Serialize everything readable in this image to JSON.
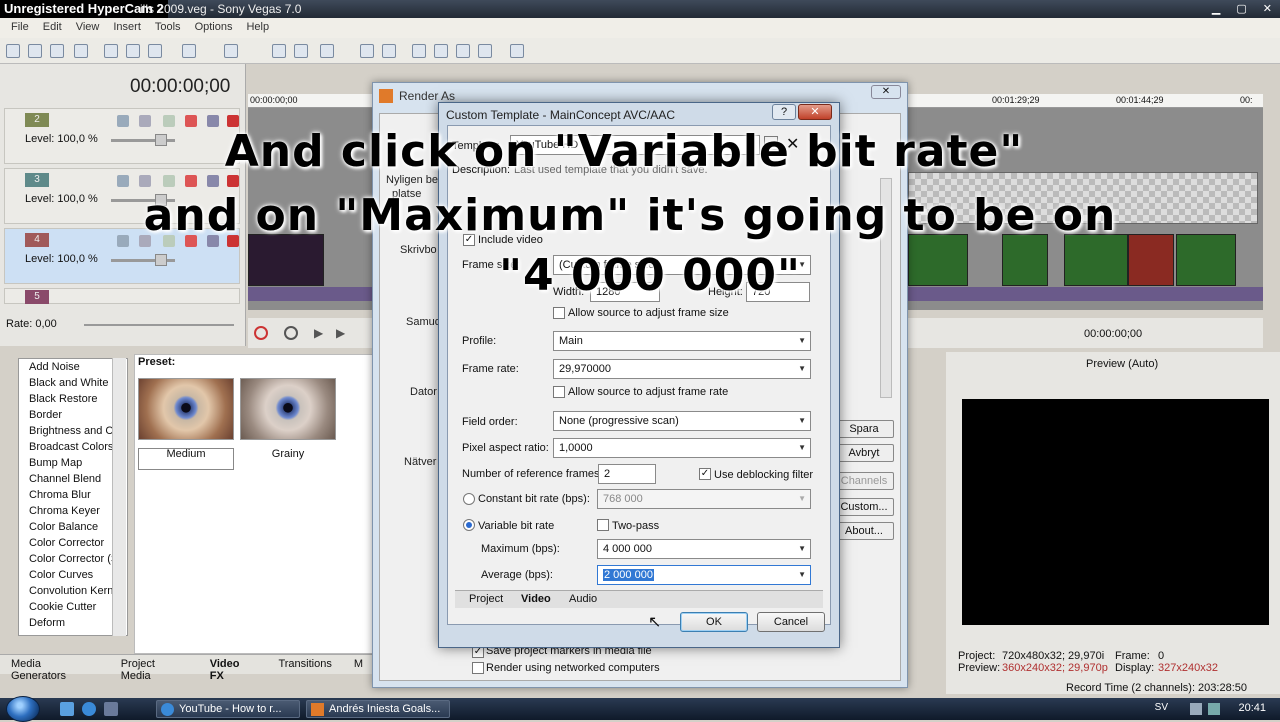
{
  "titlebar": {
    "hypercam": "Unregistered HyperCam 2",
    "title": "Andrés Iniesta Goals and Skills 2009.veg - Sony Vegas 7.0",
    "title_visible": "ills 2009.veg - Sony Vegas 7.0"
  },
  "menu": [
    "File",
    "Edit",
    "View",
    "Insert",
    "Tools",
    "Options",
    "Help"
  ],
  "timeline": {
    "timecode": "00:00:00;00",
    "ruler": [
      "00:00:00;00",
      "00:01:29;29",
      "00:01:44;29",
      "00:"
    ],
    "tracks": [
      {
        "num": "2",
        "level": "Level: 100,0 %"
      },
      {
        "num": "3",
        "level": "Level: 100,0 %"
      },
      {
        "num": "4",
        "level": "Level: 100,0 %"
      },
      {
        "num": "5"
      }
    ],
    "rate": "Rate: 0,00",
    "cursor_time": "00:00:00;00"
  },
  "fx": {
    "items": [
      "Add Noise",
      "Black and White",
      "Black Restore",
      "Border",
      "Brightness and Co",
      "Broadcast Colors",
      "Bump Map",
      "Channel Blend",
      "Chroma Blur",
      "Chroma Keyer",
      "Color Balance",
      "Color Corrector",
      "Color Corrector (S",
      "Color Curves",
      "Convolution Kerne",
      "Cookie Cutter",
      "Deform"
    ],
    "preset_label": "Preset:",
    "presets": [
      "Medium",
      "Grainy"
    ]
  },
  "bottom_tabs": [
    "Media Generators",
    "Project Media",
    "Video FX",
    "Transitions",
    "M"
  ],
  "preview": {
    "mode": "Preview (Auto)",
    "project_label": "Project:",
    "project_value": "720x480x32; 29,970i",
    "frame_label": "Frame:",
    "frame_value": "0",
    "preview_label": "Preview:",
    "preview_value": "360x240x32; 29,970p",
    "display_label": "Display:",
    "display_value": "327x240x32",
    "record_time": "Record Time (2 channels): 203:28:50"
  },
  "render_as": {
    "title": "Render As",
    "sidebar": [
      "Nyligen be",
      "platse",
      "Skrivbo",
      "Samud",
      "Dator",
      "Nätver"
    ],
    "buttons": [
      "Spara",
      "Avbryt",
      "Channels",
      "Custom...",
      "About..."
    ],
    "save_markers": "Save project markers in media file",
    "networked": "Render using networked computers"
  },
  "custom_template": {
    "title": "Custom Template - MainConcept AVC/AAC",
    "template_label": "Template:",
    "template_value": "YouTube HD",
    "description_label": "Description:",
    "description_value": "Last used template that you didn't save.",
    "include_video": "Include video",
    "frame_size_label": "Frame size:",
    "frame_size_value": "(Custom frame size)",
    "width_label": "Width:",
    "width_value": "1280",
    "height_label": "Height:",
    "height_value": "720",
    "allow_frame_size": "Allow source to adjust frame size",
    "profile_label": "Profile:",
    "profile_value": "Main",
    "frame_rate_label": "Frame rate:",
    "frame_rate_value": "29,970000",
    "allow_frame_rate": "Allow source to adjust frame rate",
    "field_order_label": "Field order:",
    "field_order_value": "None (progressive scan)",
    "par_label": "Pixel aspect ratio:",
    "par_value": "1,0000",
    "ref_frames_label": "Number of reference frames:",
    "ref_frames_value": "2",
    "deblocking": "Use deblocking filter",
    "cbr_label": "Constant bit rate (bps):",
    "cbr_value": "768 000",
    "vbr_label": "Variable bit rate",
    "twopass": "Two-pass",
    "max_label": "Maximum (bps):",
    "max_value": "4 000 000",
    "avg_label": "Average (bps):",
    "avg_value": "2 000 000",
    "tabs": [
      "Project",
      "Video",
      "Audio"
    ],
    "ok": "OK",
    "cancel": "Cancel"
  },
  "caption": {
    "line1": "And click on \"Variable bit rate\"",
    "line2": "and on \"Maximum\" it's going to be on",
    "line3": "\"4 000 000\""
  },
  "taskbar": {
    "tasks": [
      "YouTube - How to r...",
      "Andrés Iniesta Goals..."
    ],
    "lang": "SV",
    "clock": "20:41"
  }
}
